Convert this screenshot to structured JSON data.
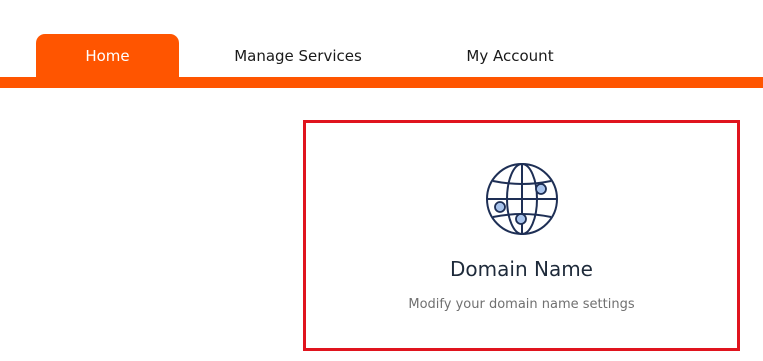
{
  "nav": {
    "tabs": [
      {
        "label": "Home",
        "active": true
      },
      {
        "label": "Manage Services",
        "active": false
      },
      {
        "label": "My Account",
        "active": false
      }
    ],
    "accent_color": "#ff5500"
  },
  "card": {
    "icon": "globe-network-icon",
    "title": "Domain Name",
    "description": "Modify your domain name settings",
    "border_color": "#e0141e"
  }
}
